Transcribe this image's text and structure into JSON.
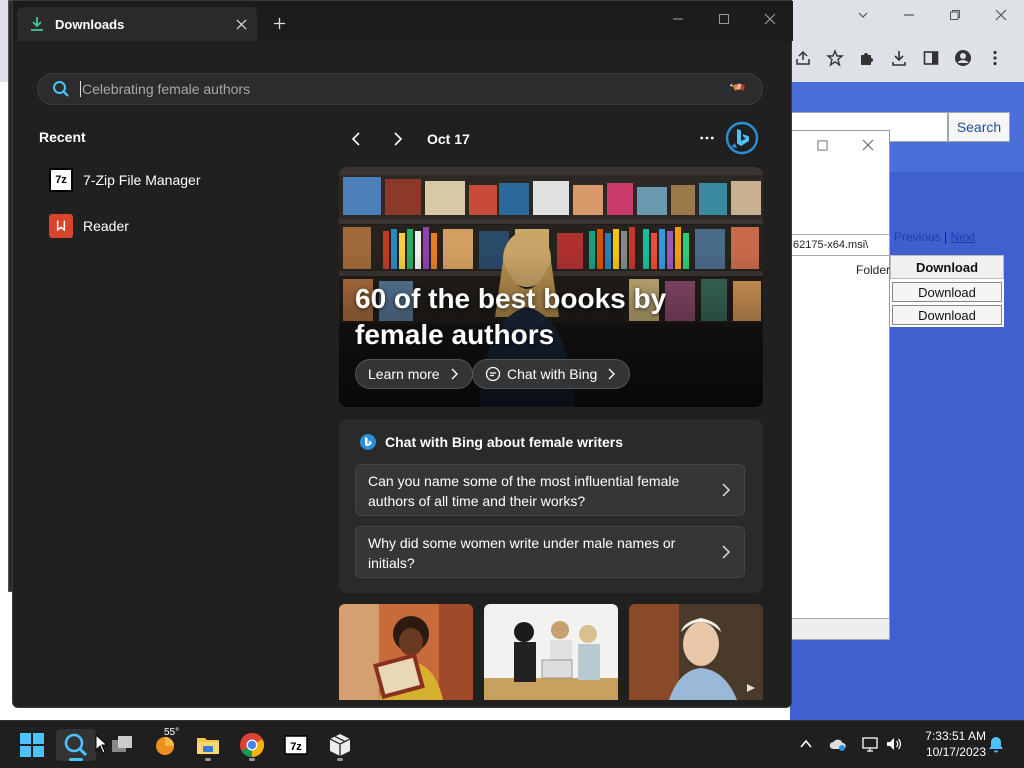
{
  "window": {
    "tab_title": "Downloads",
    "search_placeholder": "Celebrating female authors"
  },
  "recent": {
    "title": "Recent",
    "items": [
      {
        "label": "7-Zip File Manager",
        "icon": "7zip-icon"
      },
      {
        "label": "Reader",
        "icon": "reader-icon"
      }
    ]
  },
  "feed": {
    "date": "Oct 17",
    "hero": {
      "title": "60 of the best books by female authors",
      "learn_more": "Learn more",
      "chat_with_bing": "Chat with Bing"
    },
    "chat": {
      "heading": "Chat with Bing about female writers",
      "questions": [
        "Can you name some of the most influential female authors of all time and their works?",
        "Why did some women write under male names or initials?"
      ]
    }
  },
  "background_page": {
    "search_button": "Search",
    "field_value": "62175-x64.msi\\",
    "folder_label": "Folder",
    "previous": "Previous",
    "separator": "|",
    "next": "Next",
    "table_header": "Download",
    "download_buttons": [
      "Download",
      "Download"
    ]
  },
  "taskbar": {
    "weather_temp": "55°",
    "time": "7:33:51 AM",
    "date": "10/17/2023"
  },
  "colors": {
    "accent": "#4cc2ff",
    "bing_blue": "#2a8fd8",
    "window_bg": "#202020",
    "page_blue": "#3f61cf"
  }
}
